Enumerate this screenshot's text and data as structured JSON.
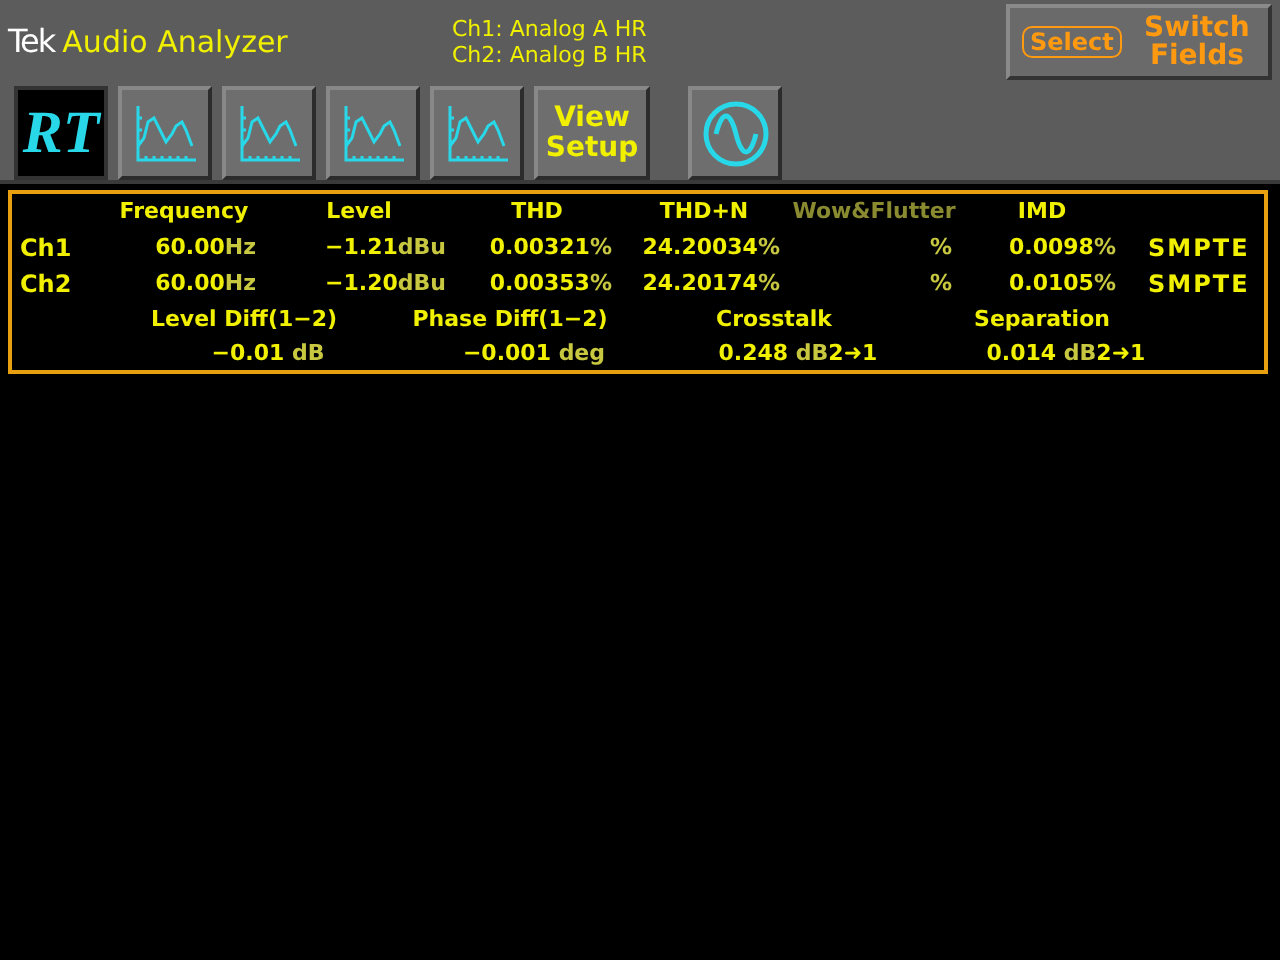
{
  "header": {
    "brand": "Tek",
    "title": "Audio Analyzer",
    "inputs": [
      "Ch1: Analog A HR",
      "Ch2: Analog B HR"
    ]
  },
  "switch_button": {
    "key": "Select",
    "label": "Switch Fields"
  },
  "toolbar": [
    {
      "kind": "text-icon",
      "label": "RT",
      "selected": true
    },
    {
      "kind": "spectrum",
      "selected": false
    },
    {
      "kind": "spectrum",
      "selected": false
    },
    {
      "kind": "spectrum",
      "selected": false
    },
    {
      "kind": "spectrum",
      "selected": false
    },
    {
      "kind": "label",
      "label": "View Setup",
      "selected": false
    },
    {
      "kind": "sine",
      "selected": false
    }
  ],
  "table": {
    "columns": [
      {
        "label": "Frequency",
        "disabled": false
      },
      {
        "label": "Level",
        "disabled": false
      },
      {
        "label": "THD",
        "disabled": false
      },
      {
        "label": "THD+N",
        "disabled": false
      },
      {
        "label": "Wow&Flutter",
        "disabled": true
      },
      {
        "label": "IMD",
        "disabled": false
      }
    ],
    "rows": [
      {
        "channel": "Ch1",
        "cells": [
          {
            "value": "60.00",
            "unit": "Hz"
          },
          {
            "value": "−1.21",
            "unit": "dBu"
          },
          {
            "value": "0.00321",
            "unit": "%"
          },
          {
            "value": "24.20034",
            "unit": "%"
          },
          {
            "unit": "%"
          },
          {
            "value": "0.0098",
            "unit": "%"
          }
        ],
        "mode": "SMPTE"
      },
      {
        "channel": "Ch2",
        "cells": [
          {
            "value": "60.00",
            "unit": "Hz"
          },
          {
            "value": "−1.20",
            "unit": "dBu"
          },
          {
            "value": "0.00353",
            "unit": "%"
          },
          {
            "value": "24.20174",
            "unit": "%"
          },
          {
            "unit": "%"
          },
          {
            "value": "0.0105",
            "unit": "%"
          }
        ],
        "mode": "SMPTE"
      }
    ]
  },
  "differences": [
    {
      "label": "Level Diff(1−2)",
      "value": "−0.01",
      "unit": "dB"
    },
    {
      "label": "Phase Diff(1−2)",
      "value": "−0.001",
      "unit": "deg"
    },
    {
      "label": "Crosstalk",
      "value": "0.248",
      "unit": "dB",
      "direction": "2➜1"
    },
    {
      "label": "Separation",
      "value": "0.014",
      "unit": "dB",
      "direction": "2➜1"
    }
  ]
}
